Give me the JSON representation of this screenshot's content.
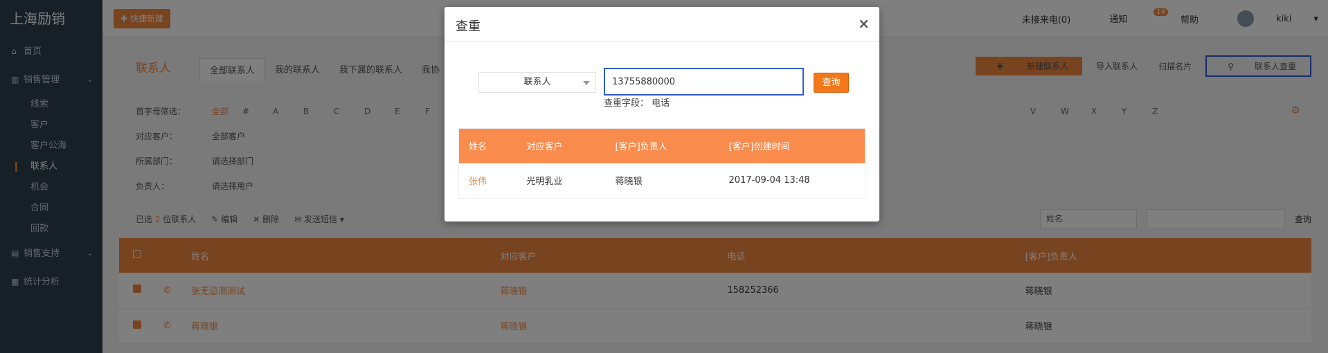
{
  "app": {
    "logo": "上海励销"
  },
  "sidebar": {
    "home": "首页",
    "sales_mgmt": "销售管理",
    "sub_items": [
      "线索",
      "客户",
      "客户公海",
      "联系人",
      "机会",
      "合同",
      "回款"
    ],
    "sales_support": "销售支持",
    "stats": "统计分析"
  },
  "topbar": {
    "quick_label": "快捷新建",
    "missed_calls": "未接来电(0)",
    "notice": "通知",
    "notice_count": "14",
    "help": "帮助",
    "user": "kiki"
  },
  "page": {
    "title": "联系人",
    "tabs": [
      "全部联系人",
      "我的联系人",
      "我下属的联系人",
      "我协"
    ],
    "btn_new": "新建联系人",
    "btn_import": "导入联系人",
    "btn_scan": "扫描名片",
    "btn_dup": "联系人查重"
  },
  "filters": {
    "letter_label": "首字母筛选：",
    "letters": [
      "全部",
      "#",
      "A",
      "B",
      "C",
      "D",
      "E",
      "F"
    ],
    "letters_right": [
      "V",
      "W",
      "X",
      "Y",
      "Z"
    ],
    "customer_label": "对应客户：",
    "customer_value": "全部客户",
    "dept_label": "所属部门：",
    "dept_value": "请选择部门",
    "owner_label": "负责人：",
    "owner_value": "请选择用户"
  },
  "actions": {
    "selected_prefix": "已选",
    "selected_count": "2",
    "selected_suffix": "位联系人",
    "edit": "编辑",
    "delete": "删除",
    "sms": "发送短信",
    "search_field": "姓名",
    "search_btn": "查询"
  },
  "grid": {
    "headers": [
      "姓名",
      "对应客户",
      "电话",
      "[客户]负责人"
    ],
    "rows": [
      [
        "张无忌测测试",
        "蒋晓银",
        "158252366",
        "蒋晓银"
      ],
      [
        "蒋晓银",
        "蒋晓银",
        "",
        "蒋晓银"
      ]
    ]
  },
  "modal": {
    "title": "查重",
    "close": "×",
    "field_select": "联系人",
    "input_value": "13755880000",
    "search_btn": "查询",
    "hint": "查重字段： 电话",
    "headers": [
      "姓名",
      "对应客户",
      "[客户]负责人",
      "[客户]创建时间"
    ],
    "rows": [
      {
        "name": "张伟",
        "customer": "光明乳业",
        "owner": "蒋晓银",
        "created": "2017-09-04 13:48"
      }
    ]
  },
  "colors": {
    "accent": "#f1863e",
    "sidebar": "#2f3e4f",
    "highlight": "#2f5bd4"
  }
}
